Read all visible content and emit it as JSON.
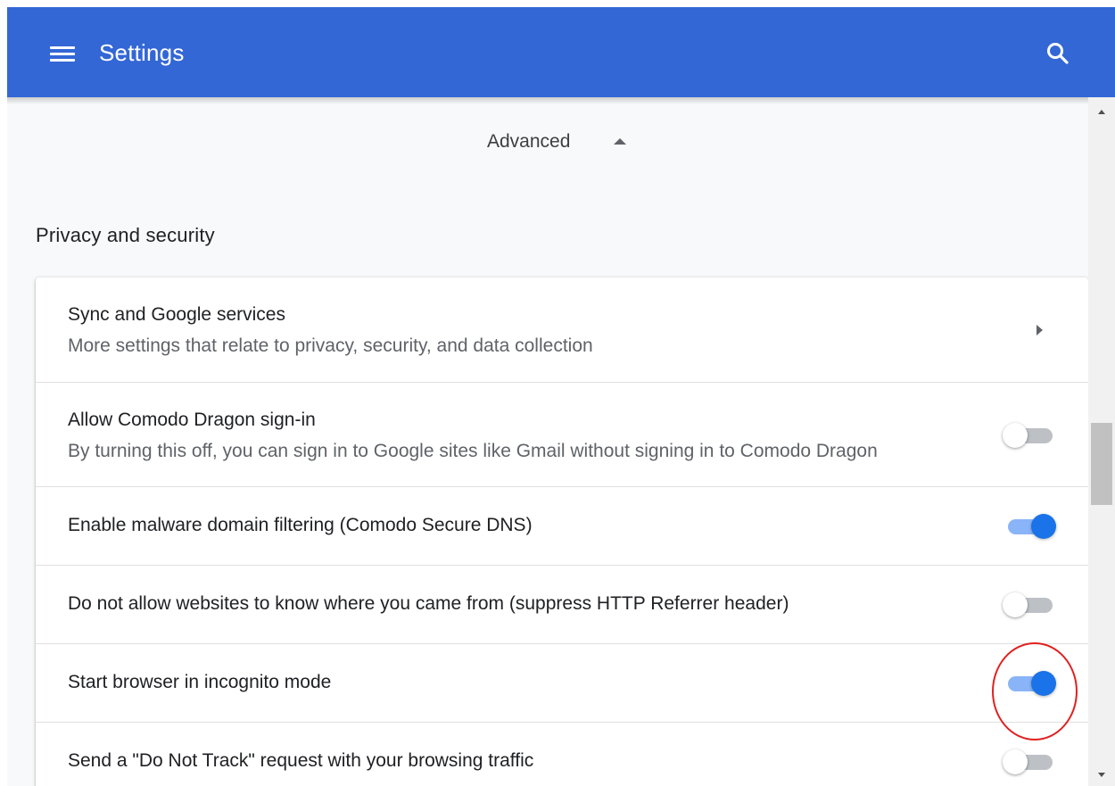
{
  "toolbar": {
    "menu_icon": "hamburger-menu-icon",
    "title": "Settings",
    "search_icon": "search-icon",
    "background_color": "#3367d6"
  },
  "advanced": {
    "label": "Advanced",
    "icon": "caret-up-icon"
  },
  "section": {
    "title": "Privacy and security"
  },
  "rows": [
    {
      "label": "Sync and Google services",
      "sublabel": "More settings that relate to privacy, security, and data collection",
      "control": "arrow",
      "icon": "chevron-right-icon"
    },
    {
      "label": "Allow Comodo Dragon sign-in",
      "sublabel": "By turning this off, you can sign in to Google sites like Gmail without signing in to Comodo Dragon",
      "control": "toggle",
      "checked": false
    },
    {
      "label": "Enable malware domain filtering (Comodo Secure DNS)",
      "control": "toggle",
      "checked": true
    },
    {
      "label": "Do not allow websites to know where you came from (suppress HTTP Referrer header)",
      "control": "toggle",
      "checked": false
    },
    {
      "label": "Start browser in incognito mode",
      "control": "toggle",
      "checked": true,
      "highlighted": true
    },
    {
      "label": "Send a \"Do Not Track\" request with your browsing traffic",
      "control": "toggle",
      "checked": false
    }
  ],
  "colors": {
    "toggle_on": "#1a73e8",
    "toggle_on_track": "#8ab4f8",
    "toggle_off_track": "#bdc1c6",
    "highlight": "#e02020"
  }
}
